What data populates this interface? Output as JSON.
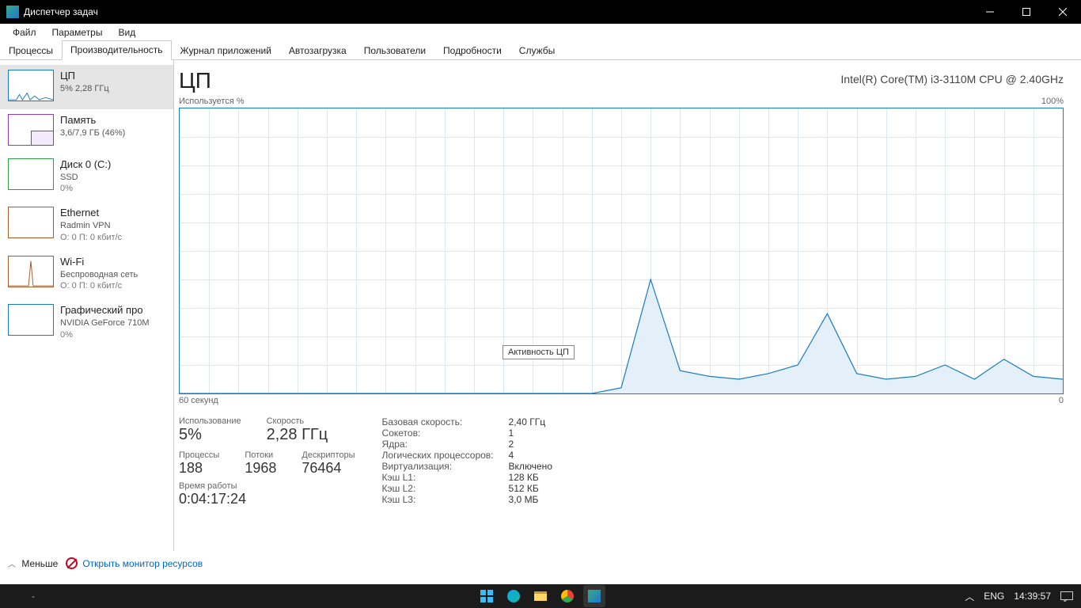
{
  "titlebar": {
    "title": "Диспетчер задач"
  },
  "menu": {
    "file": "Файл",
    "options": "Параметры",
    "view": "Вид"
  },
  "tabs": {
    "processes": "Процессы",
    "performance": "Производительность",
    "apphistory": "Журнал приложений",
    "startup": "Автозагрузка",
    "users": "Пользователи",
    "details": "Подробности",
    "services": "Службы"
  },
  "sidebar": [
    {
      "name": "ЦП",
      "sub": "5% 2,28 ГГц",
      "color": "#1b7bc0"
    },
    {
      "name": "Память",
      "sub": "3,6/7,9 ГБ (46%)",
      "color": "#8b3db4"
    },
    {
      "name": "Диск 0 (C:)",
      "sub": "SSD",
      "sub2": "0%",
      "color": "#2f9e44"
    },
    {
      "name": "Ethernet",
      "sub": "Radmin VPN",
      "sub2": "О: 0 П: 0 кбит/с",
      "color": "#a85a2a"
    },
    {
      "name": "Wi-Fi",
      "sub": "Беспроводная сеть",
      "sub2": "О: 0 П: 0 кбит/с",
      "color": "#a85a2a"
    },
    {
      "name": "Графический про",
      "sub": "NVIDIA GeForce 710M",
      "sub2": "0%",
      "color": "#1b7bc0"
    }
  ],
  "main": {
    "title": "ЦП",
    "model": "Intel(R) Core(TM) i3-3110M CPU @ 2.40GHz",
    "topleft": "Используется %",
    "topright": "100%",
    "bottomleft": "60 секунд",
    "bottomright": "0",
    "tooltip": "Активность ЦП"
  },
  "stats": {
    "usage_lbl": "Использование",
    "usage_val": "5%",
    "speed_lbl": "Скорость",
    "speed_val": "2,28 ГГц",
    "proc_lbl": "Процессы",
    "proc_val": "188",
    "threads_lbl": "Потоки",
    "threads_val": "1968",
    "handles_lbl": "Дескрипторы",
    "handles_val": "76464",
    "uptime_lbl": "Время работы",
    "uptime_val": "0:04:17:24"
  },
  "details": {
    "base_k": "Базовая скорость:",
    "base_v": "2,40 ГГц",
    "sockets_k": "Сокетов:",
    "sockets_v": "1",
    "cores_k": "Ядра:",
    "cores_v": "2",
    "lp_k": "Логических процессоров:",
    "lp_v": "4",
    "virt_k": "Виртуализация:",
    "virt_v": "Включено",
    "l1_k": "Кэш L1:",
    "l1_v": "128 КБ",
    "l2_k": "Кэш L2:",
    "l2_v": "512 КБ",
    "l3_k": "Кэш L3:",
    "l3_v": "3,0 МБ"
  },
  "footer": {
    "less": "Меньше",
    "resmon": "Открыть монитор ресурсов"
  },
  "taskbar": {
    "lang": "ENG",
    "time": "14:39:57"
  },
  "chart_data": {
    "type": "line",
    "title": "Используется %",
    "xlabel": "секунд",
    "ylabel": "%",
    "xlim": [
      60,
      0
    ],
    "ylim": [
      0,
      100
    ],
    "x": [
      60,
      58,
      56,
      54,
      52,
      50,
      48,
      46,
      44,
      42,
      40,
      38,
      36,
      34,
      32,
      30,
      28,
      26,
      24,
      22,
      20,
      18,
      16,
      14,
      12,
      10,
      8,
      6,
      4,
      2,
      0
    ],
    "values": [
      0,
      0,
      0,
      0,
      0,
      0,
      0,
      0,
      0,
      0,
      0,
      0,
      0,
      0,
      0,
      2,
      40,
      8,
      6,
      5,
      7,
      10,
      28,
      7,
      5,
      6,
      10,
      5,
      12,
      6,
      5
    ]
  },
  "colors": {
    "cpu": "#1b7bc0",
    "fill": "#e3f0fa"
  }
}
